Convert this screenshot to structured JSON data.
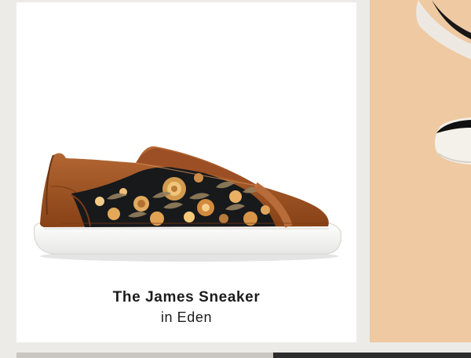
{
  "product": {
    "name": "The James Sneaker",
    "variant": "in Eden",
    "image_icon": "floral-slip-on-sneaker-image"
  },
  "adjacent_product": {
    "image_icon": "partial-sneaker-image"
  },
  "colors": {
    "page_background": "#ecebe7",
    "card_background": "#ffffff",
    "adjacent_panel": "#eec9a2",
    "leather": "#9a4f24",
    "sole": "#f4f4f2",
    "text": "#1c1c1c"
  }
}
